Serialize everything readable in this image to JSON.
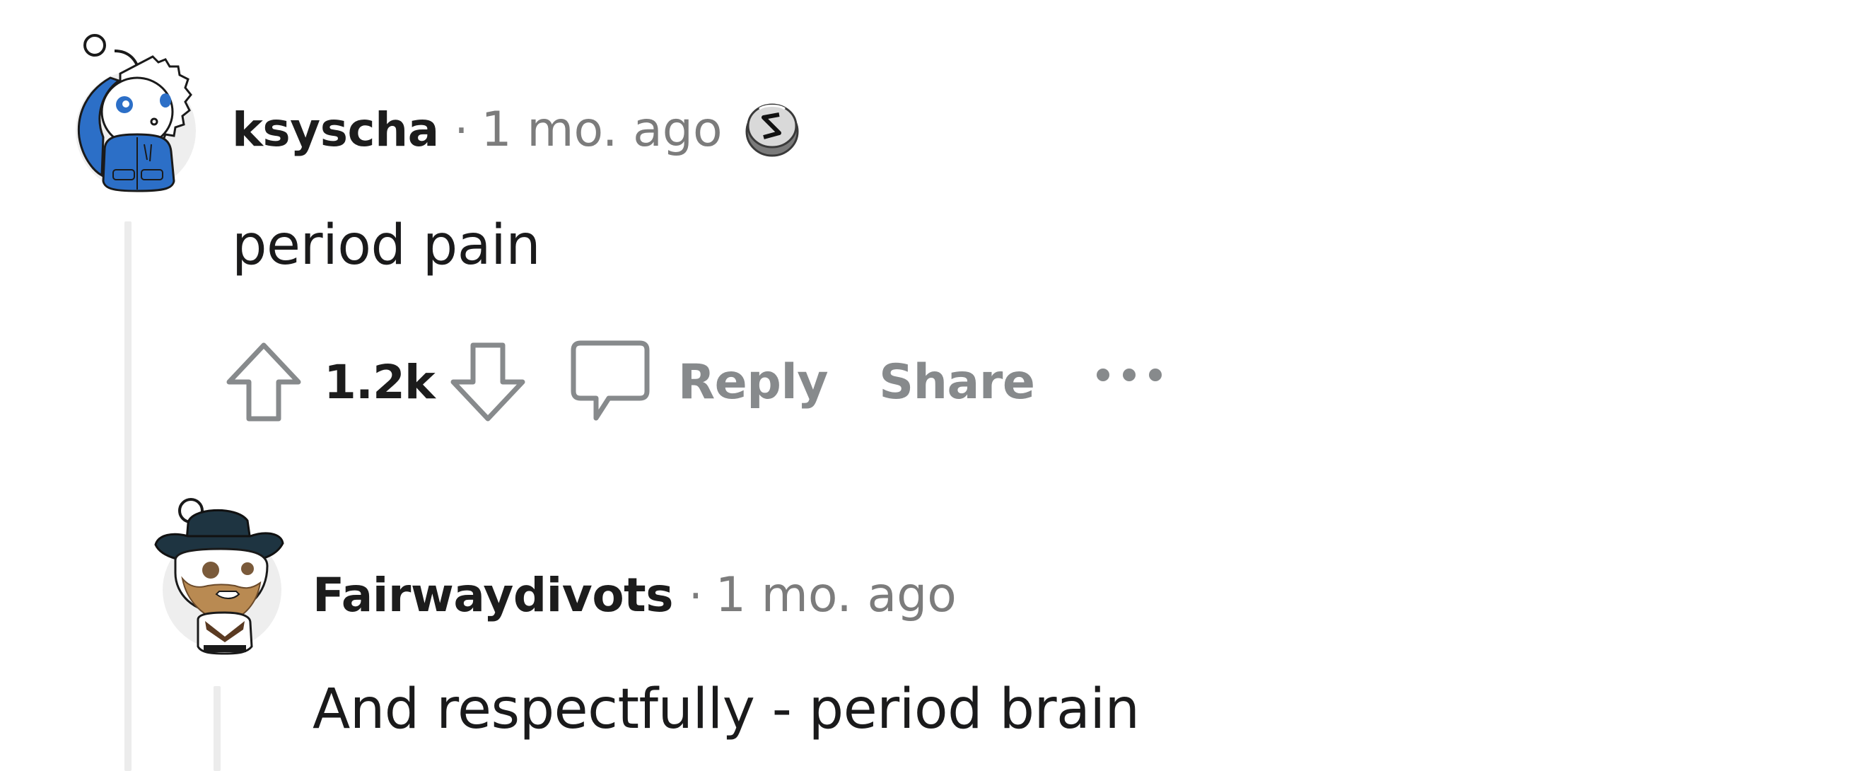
{
  "comments": [
    {
      "username": "ksyscha",
      "separator": "·",
      "time": "1 mo. ago",
      "body": "period pain",
      "votes": "1.2k",
      "reply_label": "Reply",
      "share_label": "Share",
      "avatar_icon": "snoo-blue-hoodie-avatar",
      "flair_icon": "s-badge-icon"
    },
    {
      "username": "Fairwaydivots",
      "separator": "·",
      "time": "1 mo. ago",
      "body": "And respectfully - period brain",
      "avatar_icon": "snoo-cowboy-hat-avatar"
    }
  ],
  "colors": {
    "meta_gray": "#7c7c7c",
    "action_gray": "#878a8c",
    "thread_line": "#ececec",
    "hoodie_blue": "#2c6fc7",
    "hat_navy": "#1e3441",
    "beard_brown": "#b98a52"
  }
}
